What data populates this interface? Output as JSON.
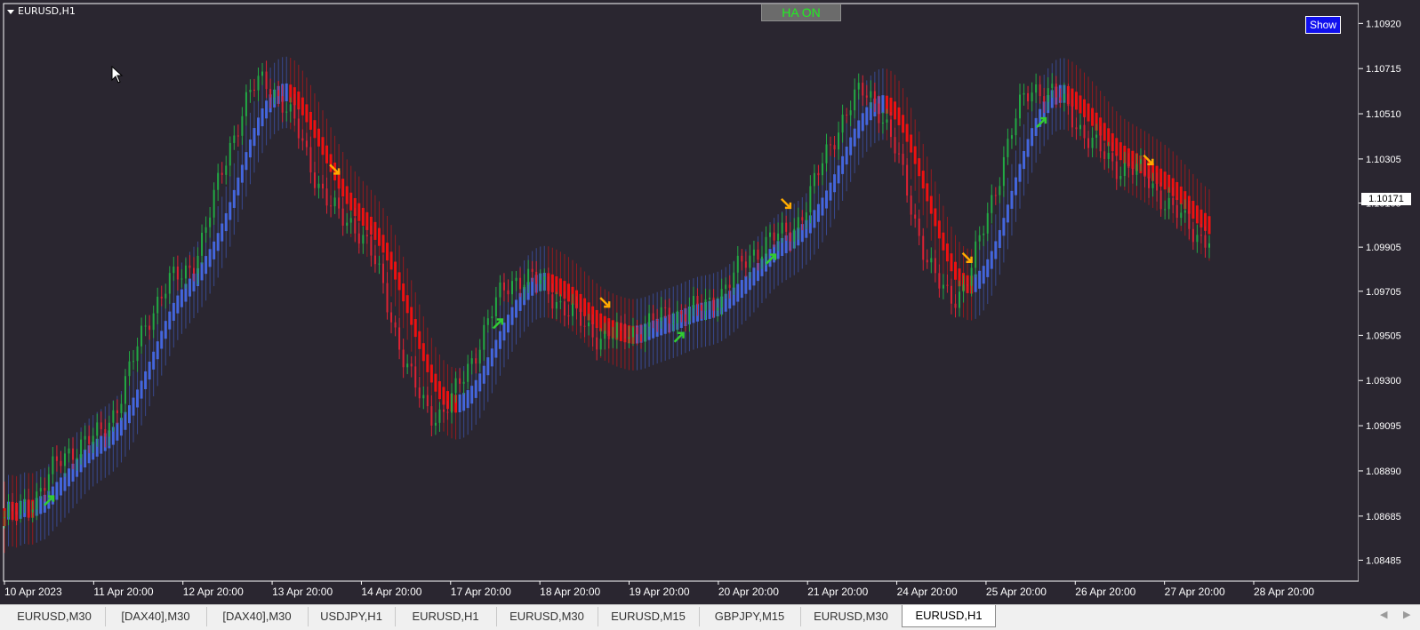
{
  "chart": {
    "symbol_label": "EURUSD,H1",
    "ha_button": "HA ON",
    "show_button": "Show",
    "current_price": "1.10171",
    "price_axis": [
      "1.10920",
      "1.10715",
      "1.10510",
      "1.10305",
      "1.10105",
      "1.09905",
      "1.09705",
      "1.09505",
      "1.09300",
      "1.09095",
      "1.08890",
      "1.08685",
      "1.08485"
    ],
    "time_axis": [
      "10 Apr 2023",
      "11 Apr 20:00",
      "12 Apr 20:00",
      "13 Apr 20:00",
      "14 Apr 20:00",
      "17 Apr 20:00",
      "18 Apr 20:00",
      "19 Apr 20:00",
      "20 Apr 20:00",
      "21 Apr 20:00",
      "24 Apr 20:00",
      "25 Apr 20:00",
      "26 Apr 20:00",
      "27 Apr 20:00",
      "28 Apr 20:00"
    ],
    "colors": {
      "background": "#2a2630",
      "bull_candle": "#22aa44",
      "bear_candle": "#dd2233",
      "band_up": "#4466dd",
      "band_down": "#ee1111",
      "arrow_up": "#33cc33",
      "arrow_down": "#ffaa00"
    }
  },
  "chart_data": {
    "type": "line",
    "title": "EURUSD,H1",
    "xlabel": "",
    "ylabel": "",
    "ylim": [
      1.0839,
      1.1101
    ],
    "x": [
      "10 Apr 2023",
      "11 Apr 20:00",
      "12 Apr 20:00",
      "13 Apr 20:00",
      "14 Apr 20:00",
      "17 Apr 20:00",
      "18 Apr 20:00",
      "19 Apr 20:00",
      "20 Apr 20:00",
      "21 Apr 20:00",
      "24 Apr 20:00",
      "25 Apr 20:00",
      "26 Apr 20:00",
      "27 Apr 20:00",
      "28 Apr 20:00"
    ],
    "series": [
      {
        "values": [
          1.0868,
          1.0903,
          1.0976,
          1.1065,
          1.1002,
          1.0915,
          1.0977,
          1.095,
          1.0962,
          1.0995,
          1.106,
          1.0968,
          1.1063,
          1.1027,
          1.0995
        ]
      }
    ],
    "signals": {
      "buy_x": [
        "10 Apr 2023",
        "17 Apr 20:00",
        "19 Apr 20:00",
        "20 Apr 20:00",
        "25 Apr 20:00"
      ],
      "sell_x": [
        "13 Apr 20:00",
        "18 Apr 20:00",
        "20 Apr 20:00",
        "24 Apr 20:00",
        "26 Apr 20:00"
      ]
    }
  },
  "tabs": [
    {
      "label": "EURUSD,M30",
      "active": false
    },
    {
      "label": "[DAX40],M30",
      "active": false
    },
    {
      "label": "[DAX40],M30",
      "active": false
    },
    {
      "label": "USDJPY,H1",
      "active": false
    },
    {
      "label": "EURUSD,H1",
      "active": false
    },
    {
      "label": "EURUSD,M30",
      "active": false
    },
    {
      "label": "EURUSD,M15",
      "active": false
    },
    {
      "label": "GBPJPY,M15",
      "active": false
    },
    {
      "label": "EURUSD,M30",
      "active": false
    },
    {
      "label": "EURUSD,H1",
      "active": true
    }
  ]
}
